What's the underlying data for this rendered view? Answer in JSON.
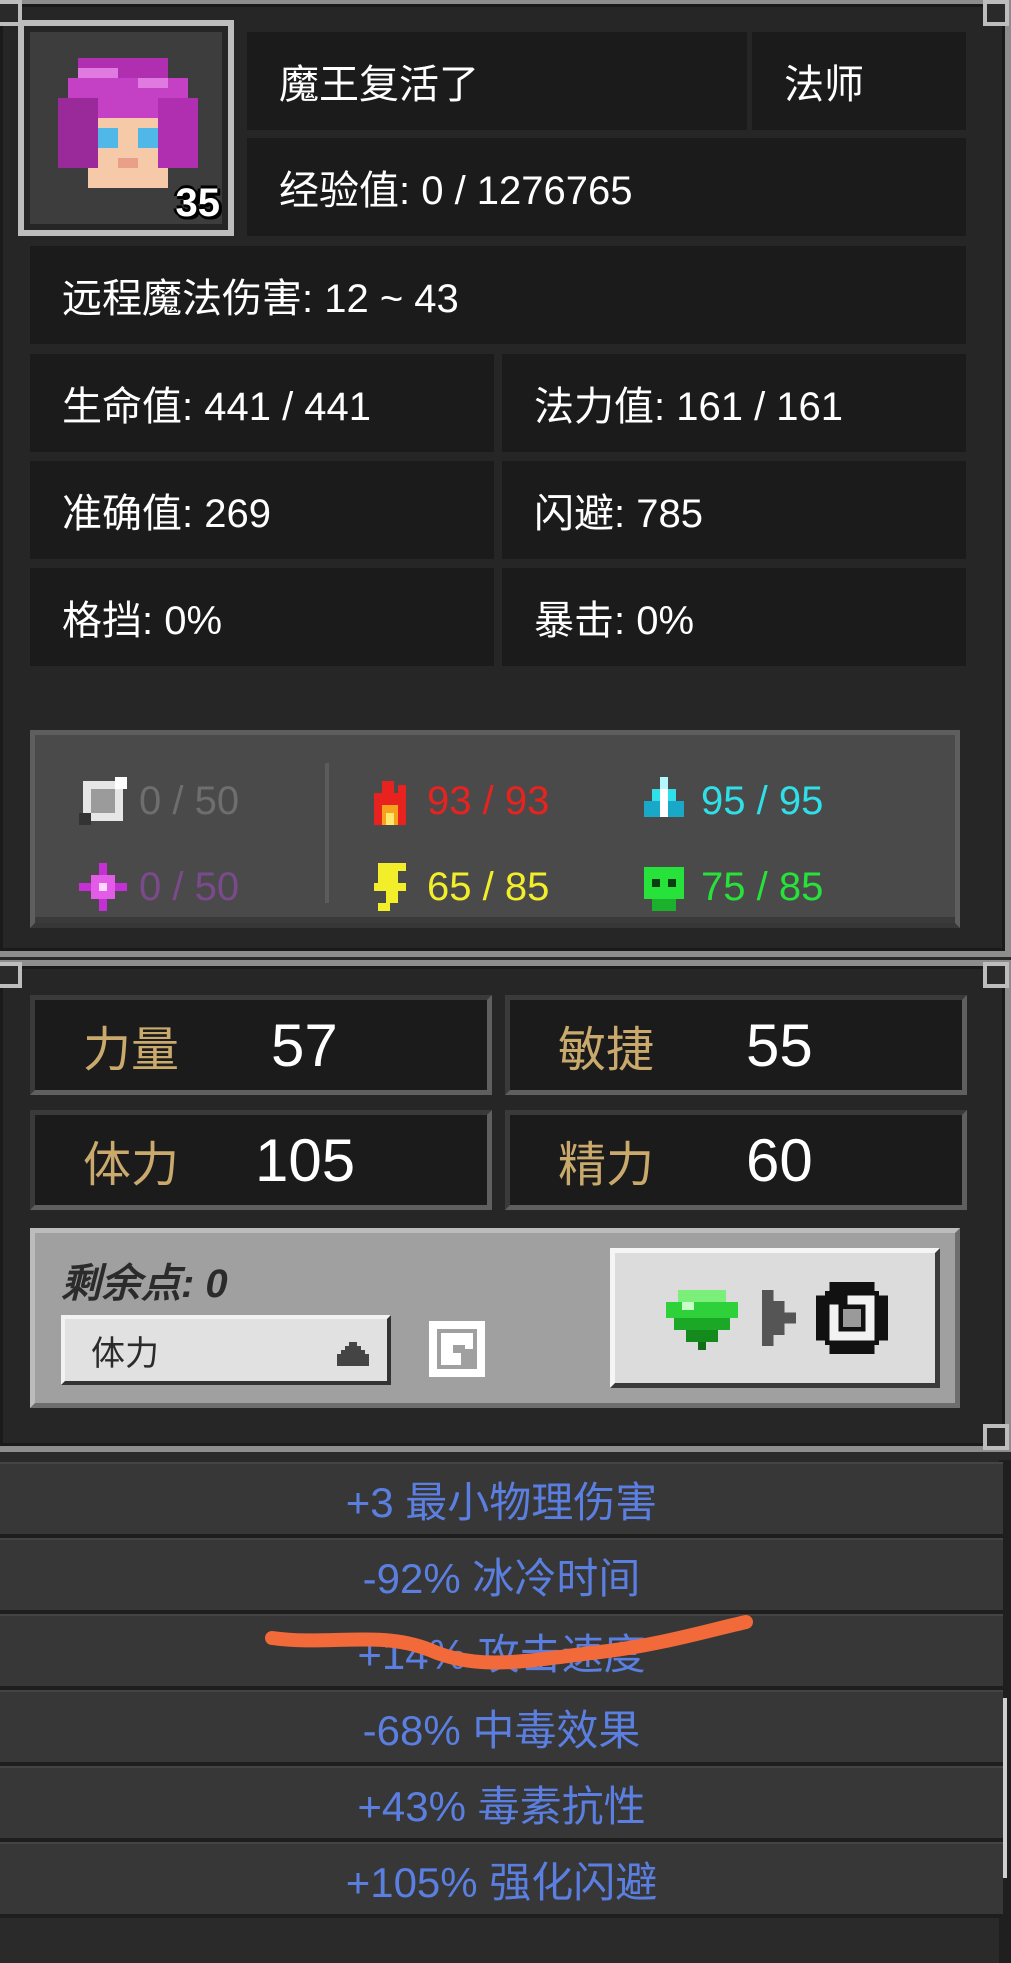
{
  "character": {
    "level": "35",
    "name": "魔王复活了",
    "class": "法师",
    "experience": "经验值: 0 / 1276765",
    "damage": "远程魔法伤害: 12 ~ 43"
  },
  "stats": {
    "hp": "生命值: 441 / 441",
    "mp": "法力值: 161 / 161",
    "accuracy": "准确值: 269",
    "evasion": "闪避: 785",
    "block": "格挡: 0%",
    "crit": "暴击: 0%"
  },
  "resistances": {
    "physical": "0 / 50",
    "fire": "93 / 93",
    "ice": "95 / 95",
    "arcane": "0 / 50",
    "lightning": "65 / 85",
    "poison": "75 / 85",
    "colors": {
      "physical": "#6e6e6e",
      "fire": "#e8231f",
      "ice": "#2fe0e8",
      "arcane": "#7a4a8c",
      "lightning": "#f2ee2a",
      "poison": "#27e23a"
    }
  },
  "attributes": {
    "strength_label": "力量",
    "strength_value": "57",
    "dexterity_label": "敏捷",
    "dexterity_value": "55",
    "vitality_label": "体力",
    "vitality_value": "105",
    "energy_label": "精力",
    "energy_value": "60"
  },
  "points": {
    "remaining": "剩余点: 0",
    "selected_attribute": "体力"
  },
  "bonuses": [
    "+3 最小物理伤害",
    "-92% 冰冷时间",
    "+14% 攻击速度",
    "-68% 中毒效果",
    "+43% 毒素抗性",
    "+105% 强化闪避"
  ],
  "icons": {
    "physical": "sword-shield-icon",
    "fire": "fire-icon",
    "ice": "ice-crystal-icon",
    "arcane": "arcane-star-icon",
    "lightning": "lightning-icon",
    "poison": "poison-skull-icon",
    "gem": "gem-icon",
    "reset": "reset-orb-icon"
  },
  "theme": {
    "accent_text": "#c9aa6c",
    "bonus_text": "#5b7fe0",
    "annotation_stroke": "#f26a3a"
  }
}
